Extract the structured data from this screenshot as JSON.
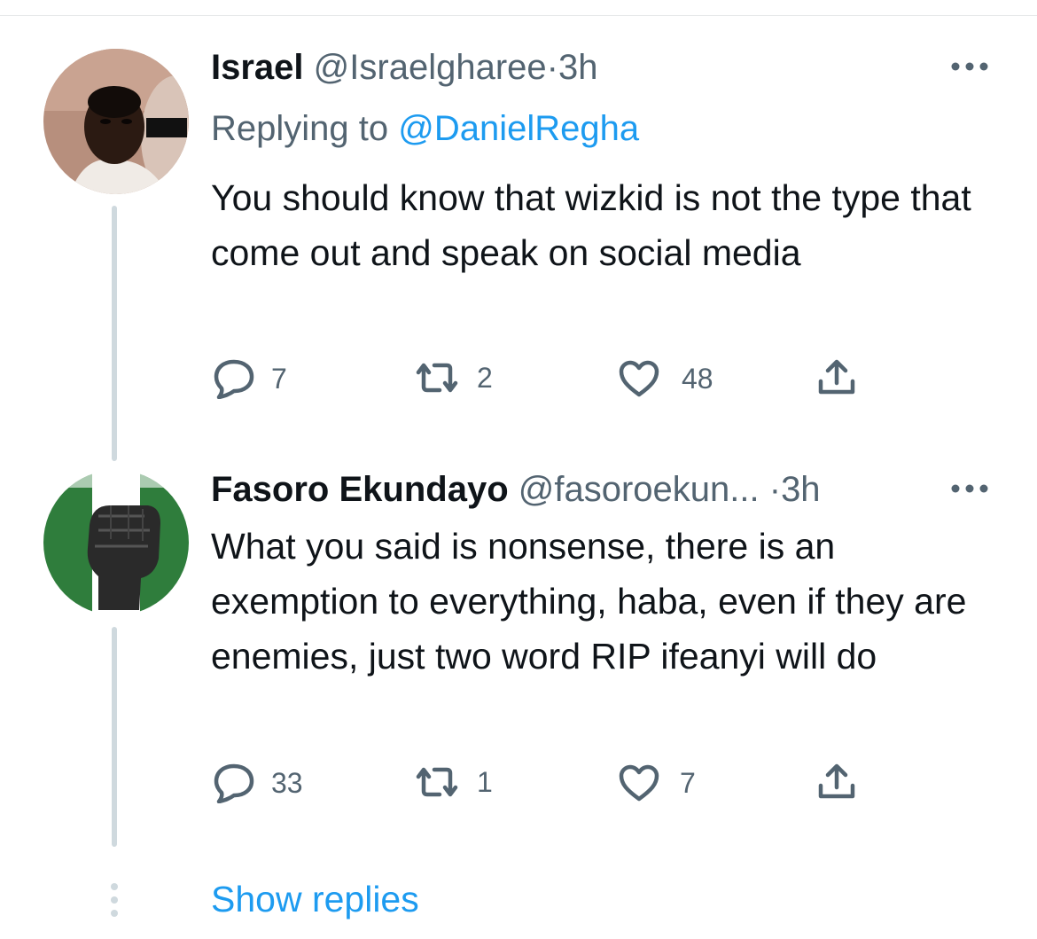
{
  "colors": {
    "text": "#0f1419",
    "secondary": "#536471",
    "accent": "#1d9bf0",
    "thread_line": "#cfd9de",
    "divider": "#e7e9ea"
  },
  "tweets": [
    {
      "name": "Israel",
      "handle": "@Israelgharee",
      "dot": "·",
      "time": "3h",
      "replying_prefix": "Replying to",
      "replying_handle": "@DanielRegha",
      "text": "You should know that wizkid is not the type that come out and speak on social media",
      "more_icon": "more-horizontal-icon",
      "actions": {
        "reply_count": "7",
        "retweet_count": "2",
        "like_count": "48",
        "share_icon": "share-icon"
      }
    },
    {
      "name": "Fasoro Ekundayo",
      "handle": "@fasoroekun...",
      "dot": "·",
      "time": "3h",
      "text": "What you said is nonsense, there is an exemption to everything, haba, even if they are enemies, just two word RIP ifeanyi will do",
      "more_icon": "more-horizontal-icon",
      "actions": {
        "reply_count": "33",
        "retweet_count": "1",
        "like_count": "7",
        "share_icon": "share-icon"
      }
    }
  ],
  "show_replies": "Show replies"
}
